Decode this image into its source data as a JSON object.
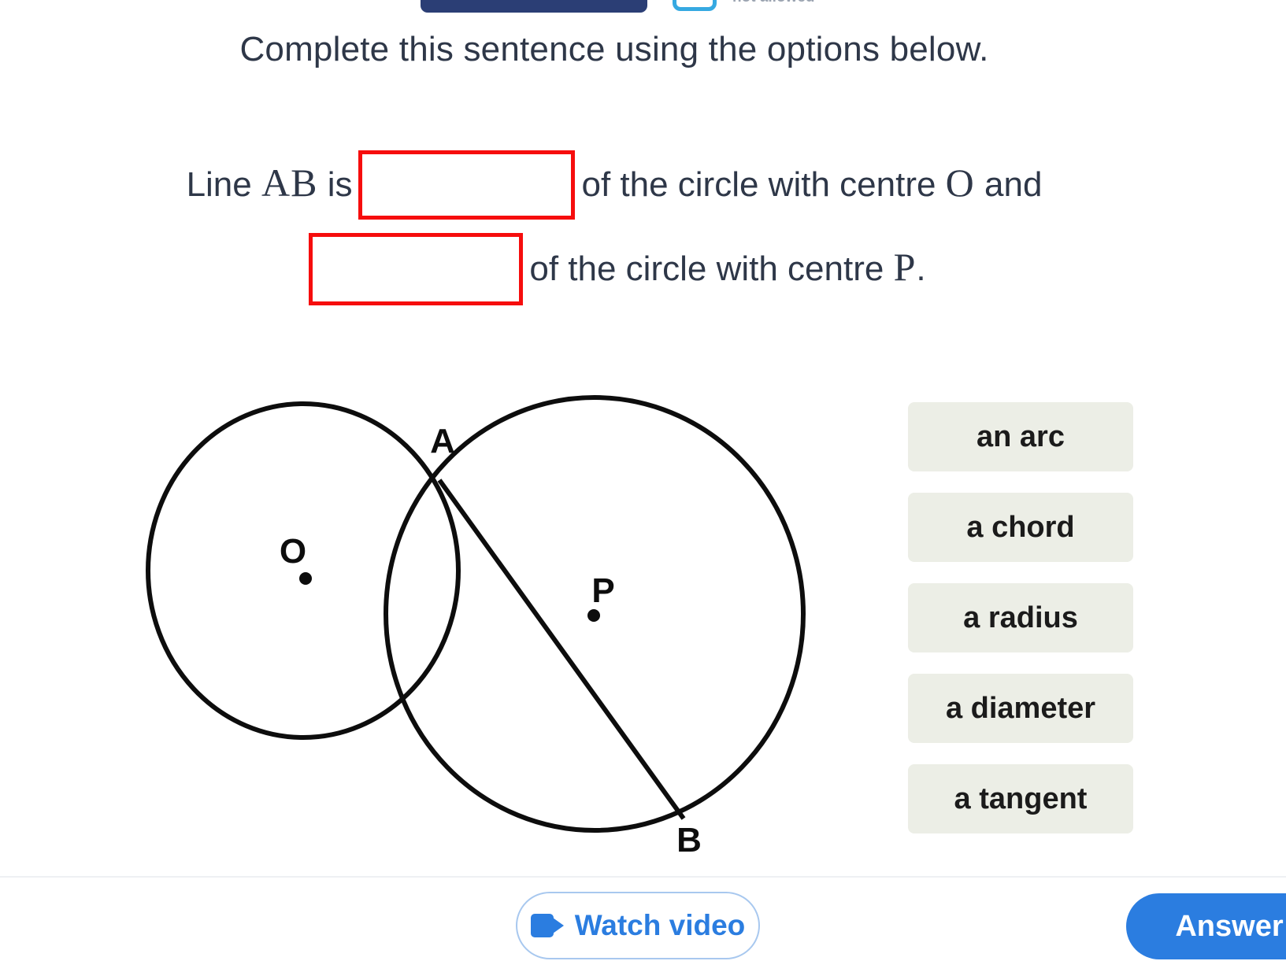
{
  "top_bar": {
    "nav_button_label": "",
    "toggle_icon": "rounded-rect-toggle-icon",
    "status_label": "not allowed"
  },
  "prompt": {
    "text": "Complete this sentence using the options below."
  },
  "sentence": {
    "line1_pre": "Line",
    "line1_var": "AB",
    "line1_is": "is",
    "blank1_value": "",
    "line1_mid": "of the circle with centre",
    "line1_var2": "O",
    "line1_and": "and",
    "blank2_value": "",
    "line2_mid": "of the circle with centre",
    "line2_var": "P",
    "line2_end": "."
  },
  "figure": {
    "labels": {
      "centre_o": "O",
      "centre_p": "P",
      "point_a": "A",
      "point_b": "B"
    },
    "stroke_color": "#0d0d0d"
  },
  "options": {
    "items": [
      {
        "label": "an arc"
      },
      {
        "label": "a chord"
      },
      {
        "label": "a radius"
      },
      {
        "label": "a diameter"
      },
      {
        "label": "a tangent"
      }
    ],
    "chip_background": "#eceee6",
    "chip_text_color": "#1b1b1b"
  },
  "bottom_bar": {
    "watch_video_label": "Watch video",
    "watch_video_icon": "video-camera-icon",
    "answer_label": "Answer",
    "accent_color": "#2b7de0"
  },
  "colors": {
    "blank_border": "#f60d0d",
    "text": "#2e3748",
    "navy": "#2b3e75",
    "cyan": "#36a9e1"
  }
}
